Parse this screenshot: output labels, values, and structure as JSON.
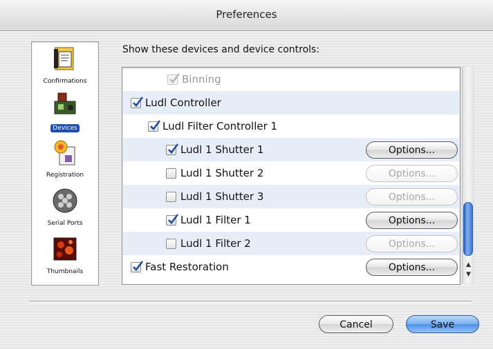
{
  "window": {
    "title": "Preferences"
  },
  "sidebar": {
    "items": [
      {
        "label": "Confirmations",
        "icon": "confirmations-icon",
        "selected": false
      },
      {
        "label": "Devices",
        "icon": "devices-icon",
        "selected": true
      },
      {
        "label": "Registration",
        "icon": "registration-icon",
        "selected": false
      },
      {
        "label": "Serial Ports",
        "icon": "serial-ports-icon",
        "selected": false
      },
      {
        "label": "Thumbnails",
        "icon": "thumbnails-icon",
        "selected": false
      }
    ]
  },
  "main": {
    "heading": "Show these devices and device controls:",
    "devices": [
      {
        "label": "Binning",
        "checked": true,
        "enabled": false,
        "options": null
      },
      {
        "label": "Ludl Controller",
        "checked": true,
        "enabled": true,
        "options": null
      },
      {
        "label": "Ludl Filter Controller 1",
        "checked": true,
        "enabled": true,
        "options": null
      },
      {
        "label": "Ludl 1 Shutter 1",
        "checked": true,
        "enabled": true,
        "options": {
          "label": "Options...",
          "enabled": true
        }
      },
      {
        "label": "Ludl 1 Shutter 2",
        "checked": false,
        "enabled": true,
        "options": {
          "label": "Options...",
          "enabled": false
        }
      },
      {
        "label": "Ludl 1 Shutter 3",
        "checked": false,
        "enabled": true,
        "options": {
          "label": "Options...",
          "enabled": false
        }
      },
      {
        "label": "Ludl 1 Filter 1",
        "checked": true,
        "enabled": true,
        "options": {
          "label": "Options...",
          "enabled": true
        }
      },
      {
        "label": "Ludl 1 Filter 2",
        "checked": false,
        "enabled": true,
        "options": {
          "label": "Options...",
          "enabled": false
        }
      },
      {
        "label": "Fast Restoration",
        "checked": true,
        "enabled": true,
        "options": {
          "label": "Options...",
          "enabled": true
        }
      }
    ]
  },
  "footer": {
    "cancel_label": "Cancel",
    "save_label": "Save"
  },
  "colors": {
    "accent": "#1c4fb0",
    "check": "#1d4f9e",
    "row_alt": "#e8eef8",
    "save_button": "#4f8fe5"
  }
}
